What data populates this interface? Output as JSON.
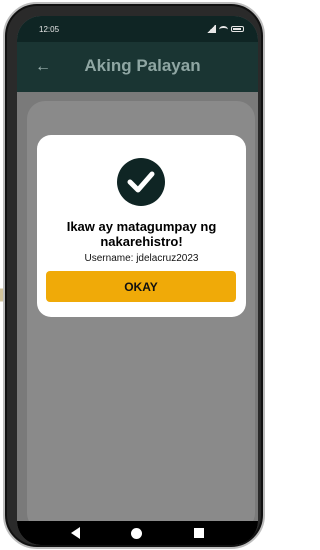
{
  "status_bar": {
    "time": "12:05"
  },
  "app_bar": {
    "title": "Aking Palayan",
    "back_icon": "arrow-left-icon"
  },
  "dialog": {
    "icon": "check-circle-icon",
    "title": "Ikaw ay matagumpay ng nakarehistro!",
    "username_line": "Username: jdelacruz2023",
    "button_label": "OKAY"
  },
  "colors": {
    "header_dark": "#0f2524",
    "app_bar": "#1a3533",
    "accent_button": "#f0aa08",
    "overlay": "#7a7a7a"
  },
  "nav_bar": {
    "back": "triangle-back-icon",
    "home": "circle-home-icon",
    "recents": "square-recents-icon"
  }
}
